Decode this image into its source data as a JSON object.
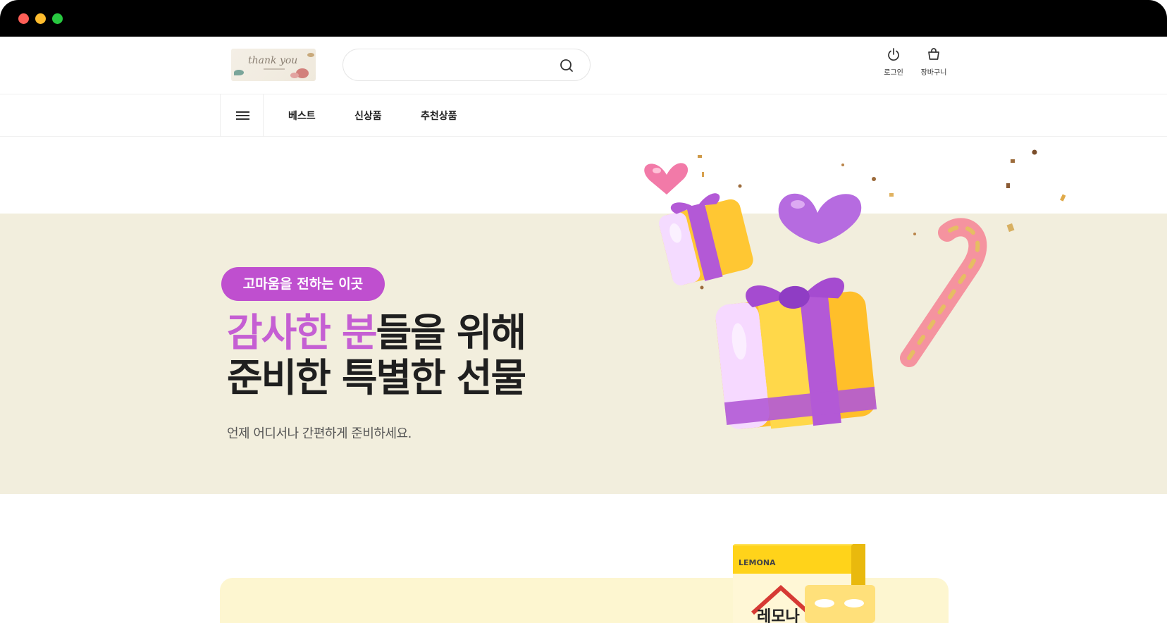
{
  "window": {
    "controls": [
      "close",
      "minimize",
      "maximize"
    ]
  },
  "header": {
    "logo": {
      "text": "thank you"
    },
    "search": {
      "value": "",
      "placeholder": ""
    },
    "login_label": "로그인",
    "cart_label": "장바구니"
  },
  "nav": {
    "items": [
      {
        "label": "베스트"
      },
      {
        "label": "신상품"
      },
      {
        "label": "추천상품"
      }
    ]
  },
  "hero": {
    "badge": "고마움을 전하는 이곳",
    "headline_accent": "감사한 분",
    "headline_rest": "들을 위해",
    "headline_line2": "준비한 특별한 선물",
    "subtitle": "언제 어디서나 간편하게 준비하세요.",
    "colors": {
      "band": "#f2eedd",
      "accent": "#c55fd3",
      "badge": "#bf4fcf"
    }
  },
  "product_box": {
    "brand": "LEMONA",
    "name": "레모나"
  }
}
